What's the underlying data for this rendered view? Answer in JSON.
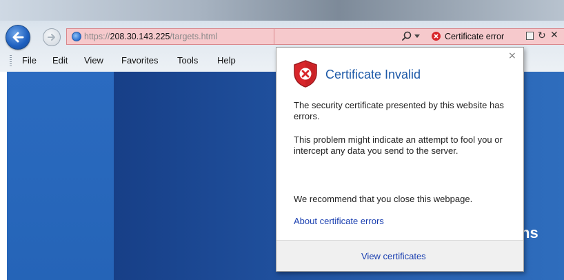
{
  "browser": {
    "url_prefix": "https://",
    "url_host": "208.30.143.225",
    "url_path": "/targets.html",
    "cert_error_label": "Certificate error",
    "icons": {
      "back": "back-arrow-icon",
      "forward": "forward-arrow-icon",
      "page": "page-globe-icon",
      "search": "search-icon",
      "cert_error": "certificate-error-icon",
      "compat": "compatibility-view-icon",
      "refresh": "refresh-icon",
      "stop": "stop-icon"
    },
    "colors": {
      "address_error_bg": "#f6c9cc",
      "cert_error_red": "#d8262b"
    }
  },
  "menubar": {
    "items": [
      {
        "label": "File"
      },
      {
        "label": "Edit"
      },
      {
        "label": "View"
      },
      {
        "label": "Favorites"
      },
      {
        "label": "Tools"
      },
      {
        "label": "Help"
      }
    ]
  },
  "page": {
    "partial_heading": "ns"
  },
  "certificate_popup": {
    "close_glyph": "×",
    "title": "Certificate Invalid",
    "paragraph_1": "The security certificate presented by this website has errors.",
    "paragraph_2": "This problem might indicate an attempt to fool you or intercept any data you send to the server.",
    "paragraph_3": "We recommend that you close this webpage.",
    "link": "About certificate errors",
    "footer_button": "View certificates",
    "colors": {
      "title": "#1e5aa8",
      "link": "#1a3fb0",
      "shield_red": "#d8262b"
    }
  }
}
